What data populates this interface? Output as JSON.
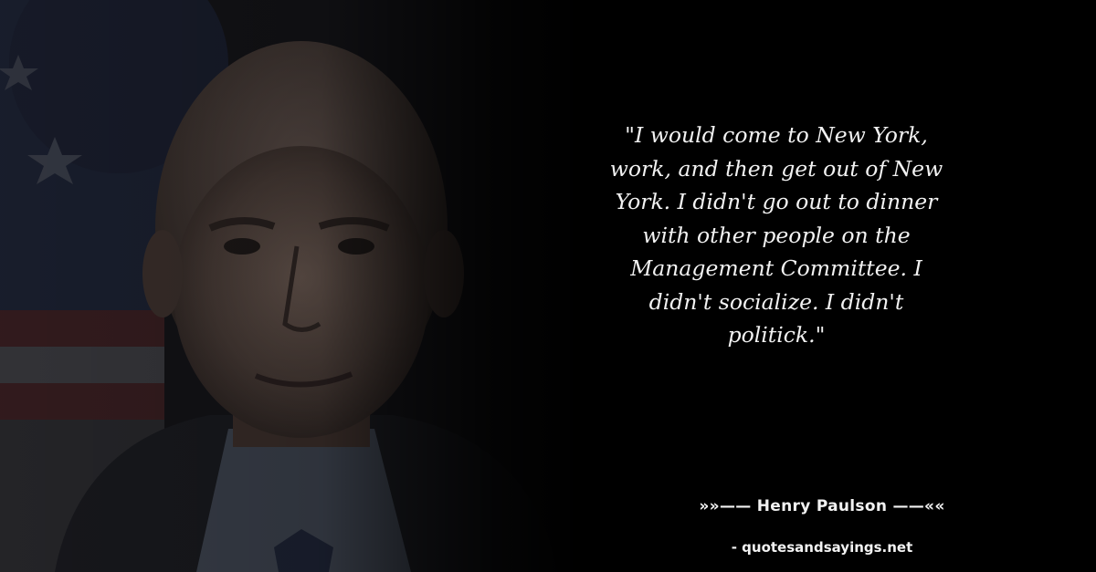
{
  "quote": {
    "text": "\"I would come to New York, work, and then get out of New York. I didn't go out to dinner with other people on the Management Committee. I didn't socialize. I didn't politick.\""
  },
  "author": {
    "line": "»»—— Henry Paulson ——««"
  },
  "source": {
    "line": "- quotesandsayings.net"
  },
  "colors": {
    "background": "#000000",
    "text": "#f2f2f2"
  }
}
